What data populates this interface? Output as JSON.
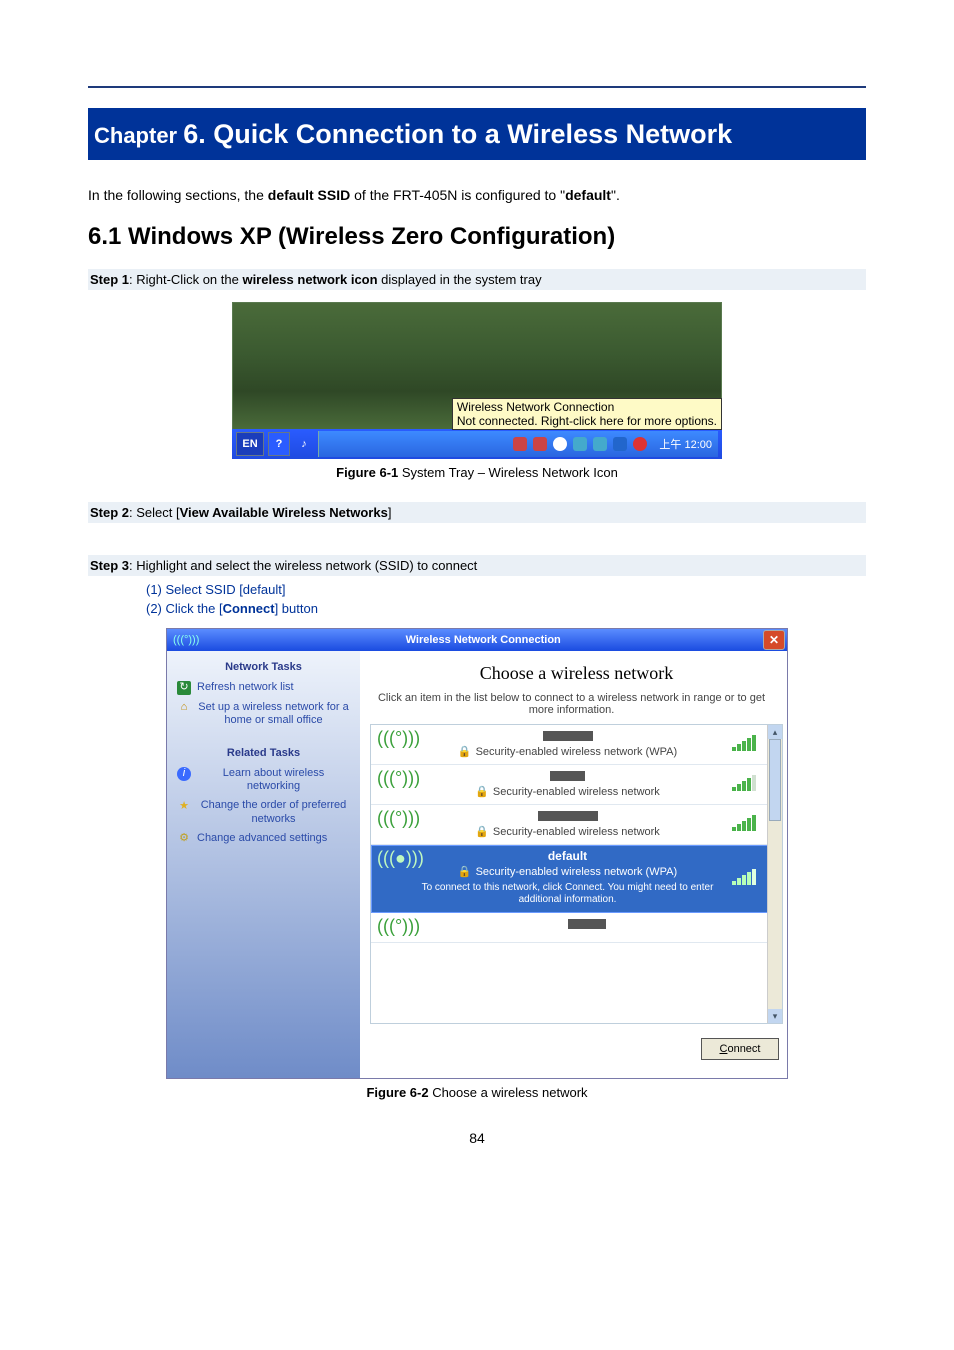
{
  "chapter": {
    "prefix": "Chapter ",
    "number_title": "6. Quick Connection to a Wireless Network"
  },
  "intro": {
    "t1": "In the following sections, the ",
    "b1": "default SSID",
    "t2": " of the FRT-405N is configured to \"",
    "b2": "default",
    "t3": "\"."
  },
  "section_6_1": "6.1 Windows XP (Wireless Zero Configuration)",
  "step1": {
    "b1": "Step 1",
    "t1": ": Right-Click on the ",
    "b2": "wireless network icon",
    "t2": " displayed in the system tray"
  },
  "caption1": {
    "b": "Figure 6-1",
    "t": " System Tray – Wireless Network Icon"
  },
  "step2": {
    "b1": "Step 2",
    "t1": ": Select [",
    "b2": "View Available Wireless Networks",
    "t2": "]"
  },
  "step3": {
    "b1": "Step 3",
    "t1": ": Highlight and select the wireless network (SSID) to connect"
  },
  "substeps": {
    "s1": "(1)  Select SSID [default]",
    "s2a": "(2)  Click the [",
    "s2b": "Connect",
    "s2c": "] button"
  },
  "fig1": {
    "tooltip_line1": "Wireless Network Connection",
    "tooltip_line2": "Not connected. Right-click here for more options.",
    "lang": "EN",
    "help": "?",
    "clock": "上午 12:00"
  },
  "fig2": {
    "title_prefix": "(((°)))",
    "title": "Wireless Network Connection",
    "close": "✕",
    "left": {
      "head1": "Network Tasks",
      "refresh": "Refresh network list",
      "setup": "Set up a wireless network for a home or small office",
      "head2": "Related Tasks",
      "learn": "Learn about wireless networking",
      "order": "Change the order of preferred networks",
      "adv": "Change advanced settings"
    },
    "right": {
      "title": "Choose a wireless network",
      "sub": "Click an item in the list below to connect to a wireless network in range or to get more information.",
      "sec_wpa": "Security-enabled wireless network (WPA)",
      "sec": "Security-enabled wireless network",
      "ssid_default": "default",
      "sel_note": "To connect to this network, click Connect. You might need to enter additional information.",
      "connect": "Connect"
    }
  },
  "caption2": {
    "b": "Figure 6-2",
    "t": " Choose a wireless network"
  },
  "page_number": "84"
}
